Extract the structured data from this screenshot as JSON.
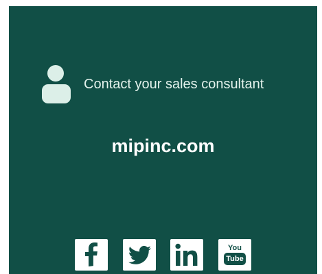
{
  "colors": {
    "panel_background": "#114f46",
    "icon_fill": "#dcefe8",
    "text": "#e3f2ec",
    "link_text": "#ffffff"
  },
  "contact": {
    "icon": "person-icon",
    "label": "Contact your sales consultant"
  },
  "website": {
    "label": "mipinc.com"
  },
  "social": [
    {
      "name": "Facebook",
      "icon": "facebook-icon"
    },
    {
      "name": "Twitter",
      "icon": "twitter-icon"
    },
    {
      "name": "LinkedIn",
      "icon": "linkedin-icon"
    },
    {
      "name": "YouTube",
      "icon": "youtube-icon",
      "logo_text_top": "You",
      "logo_text_bottom": "Tube"
    }
  ]
}
